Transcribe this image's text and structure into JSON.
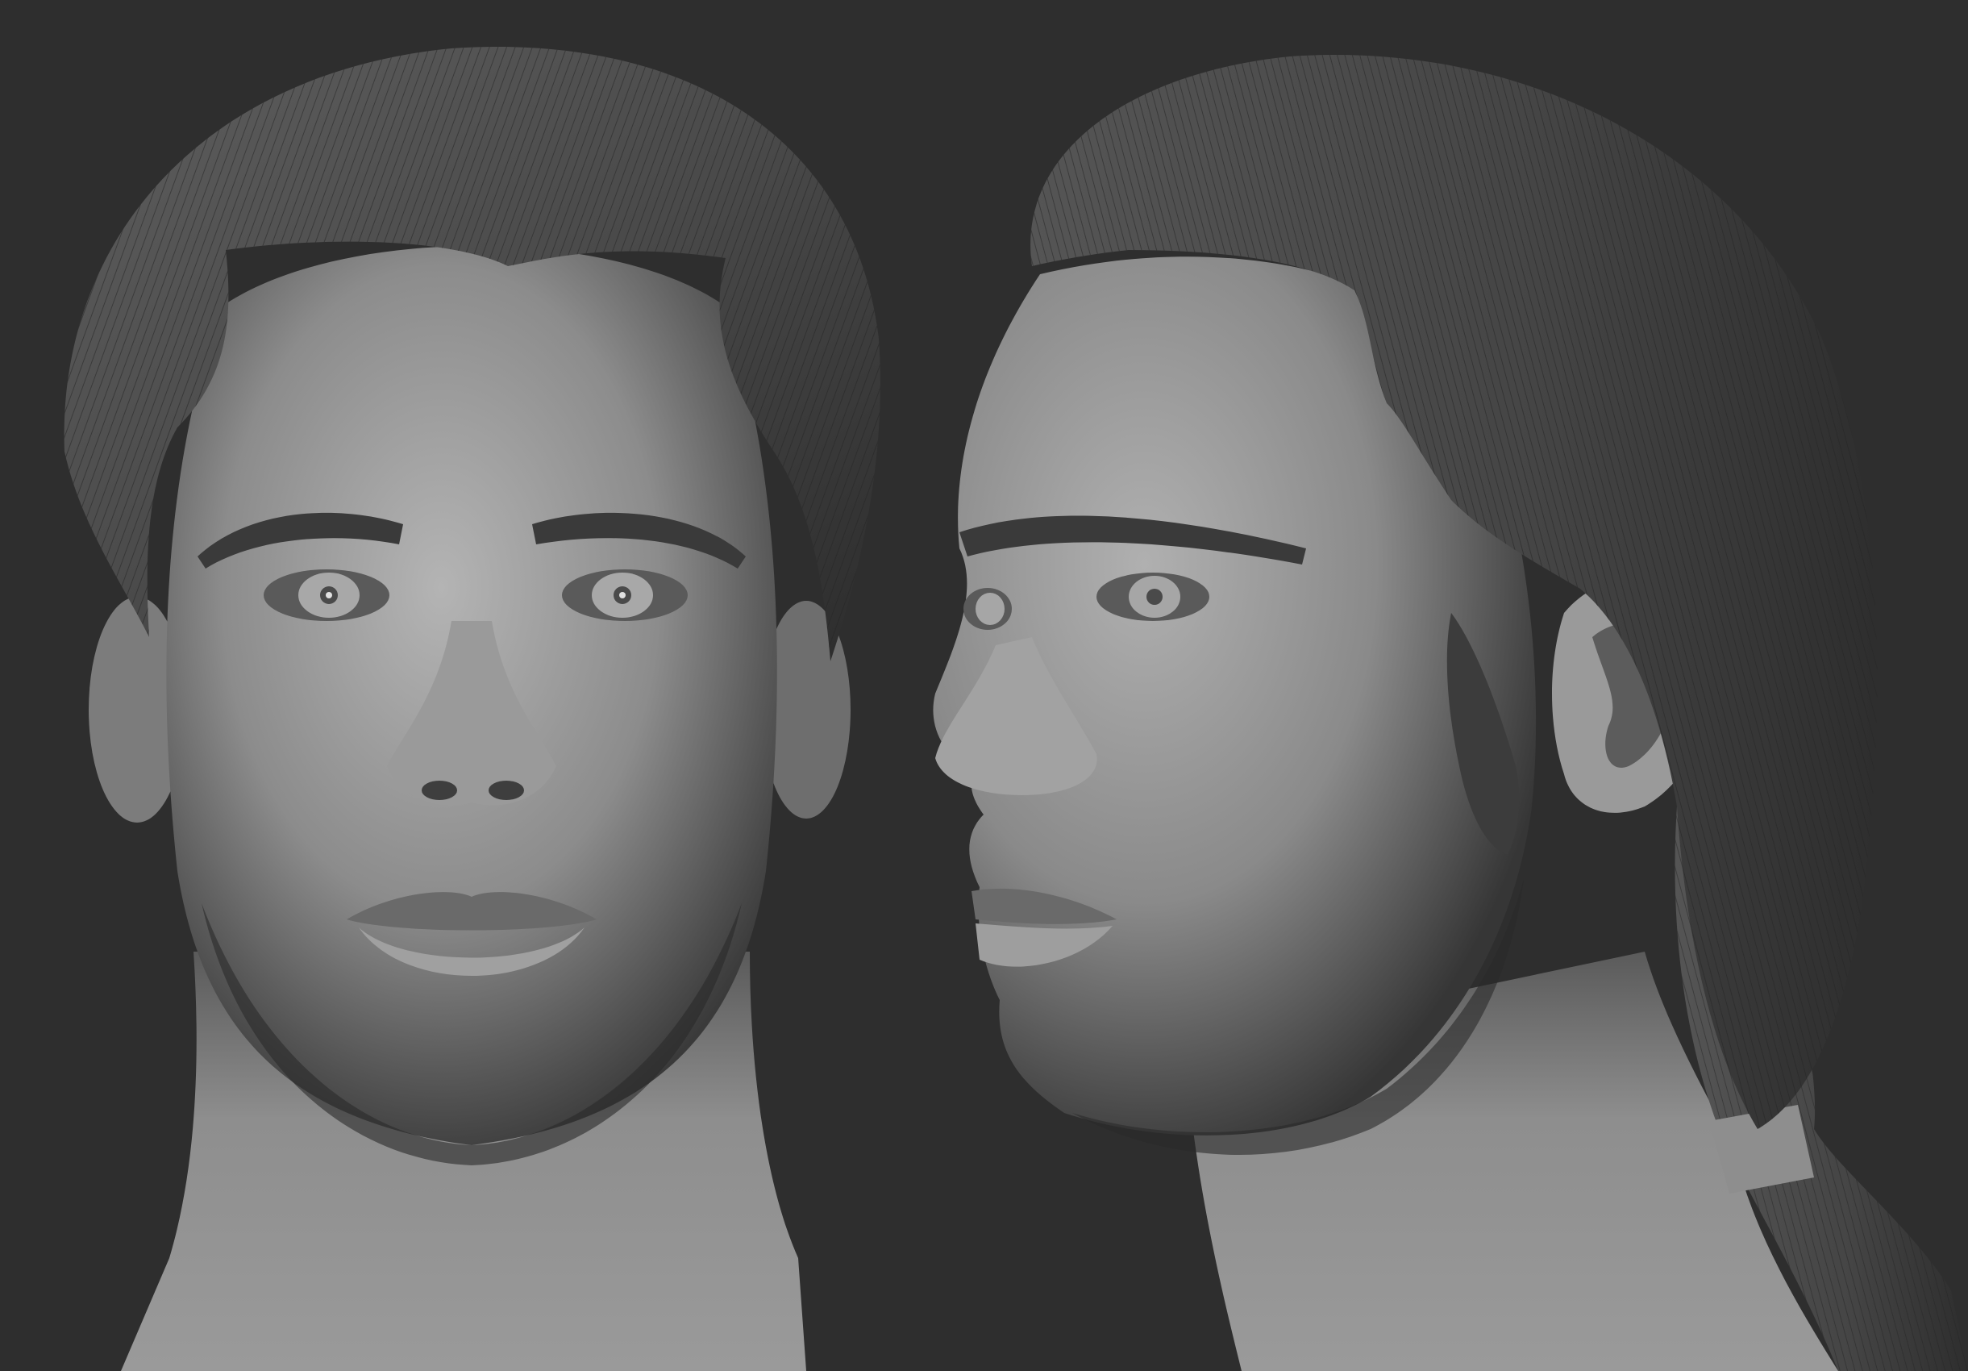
{
  "image": {
    "description_visible_text": "",
    "background_color": "#2e2e2e",
    "clay_color": "#8a8a8a",
    "panels": [
      {
        "name": "front-view"
      },
      {
        "name": "side-view"
      }
    ]
  }
}
